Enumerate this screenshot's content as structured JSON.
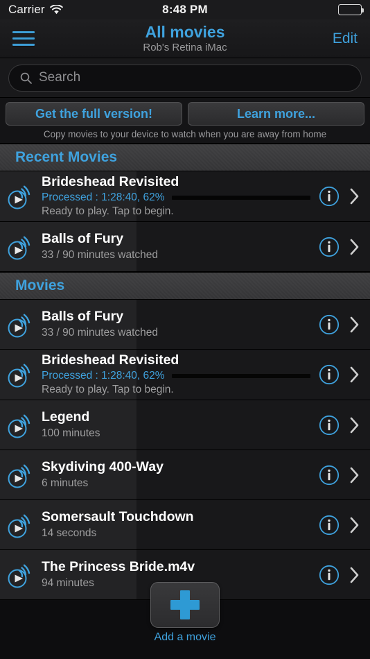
{
  "status_bar": {
    "carrier": "Carrier",
    "wifi_icon": "wifi-icon",
    "time": "8:48 PM",
    "battery_icon": "battery-full-icon",
    "battery_level": 100
  },
  "nav_bar": {
    "menu_icon": "hamburger-menu-icon",
    "title": "All movies",
    "subtitle": "Rob's Retina iMac",
    "edit_label": "Edit"
  },
  "search": {
    "icon": "search-icon",
    "placeholder": "Search",
    "value": ""
  },
  "promo": {
    "primary_label": "Get the full version!",
    "secondary_label": "Learn more...",
    "note": "Copy movies to your device to watch when you are away from home"
  },
  "accent_color": "#3fa2de",
  "progress_color": "#54aede",
  "sections": [
    {
      "header": "Recent Movies",
      "rows": [
        {
          "icon": "stream-play-icon",
          "title": "Brideshead Revisited",
          "processed": "Processed : 1:28:40, 62%",
          "progress_percent": 62,
          "status": "Ready to play. Tap to begin.",
          "info_icon": "info-circle-icon",
          "chevron_icon": "chevron-right-icon"
        },
        {
          "icon": "stream-play-icon",
          "title": "Balls of Fury",
          "subtitle": "33 / 90 minutes watched",
          "info_icon": "info-circle-icon",
          "chevron_icon": "chevron-right-icon"
        }
      ]
    },
    {
      "header": "Movies",
      "rows": [
        {
          "icon": "stream-play-icon",
          "title": "Balls of Fury",
          "subtitle": "33 / 90 minutes watched",
          "info_icon": "info-circle-icon",
          "chevron_icon": "chevron-right-icon"
        },
        {
          "icon": "stream-play-icon",
          "title": "Brideshead Revisited",
          "processed": "Processed : 1:28:40, 62%",
          "progress_percent": 62,
          "status": "Ready to play. Tap to begin.",
          "info_icon": "info-circle-icon",
          "chevron_icon": "chevron-right-icon"
        },
        {
          "icon": "stream-play-icon",
          "title": "Legend",
          "subtitle": "100 minutes",
          "info_icon": "info-circle-icon",
          "chevron_icon": "chevron-right-icon"
        },
        {
          "icon": "stream-play-icon",
          "title": "Skydiving 400-Way",
          "subtitle": "6 minutes",
          "info_icon": "info-circle-icon",
          "chevron_icon": "chevron-right-icon"
        },
        {
          "icon": "stream-play-icon",
          "title": "Somersault Touchdown",
          "subtitle": "14 seconds",
          "info_icon": "info-circle-icon",
          "chevron_icon": "chevron-right-icon"
        },
        {
          "icon": "stream-play-icon",
          "title": "The Princess Bride.m4v",
          "subtitle": "94 minutes",
          "info_icon": "info-circle-icon",
          "chevron_icon": "chevron-right-icon"
        }
      ]
    }
  ],
  "add_button": {
    "icon": "plus-icon",
    "label": "Add a movie"
  }
}
